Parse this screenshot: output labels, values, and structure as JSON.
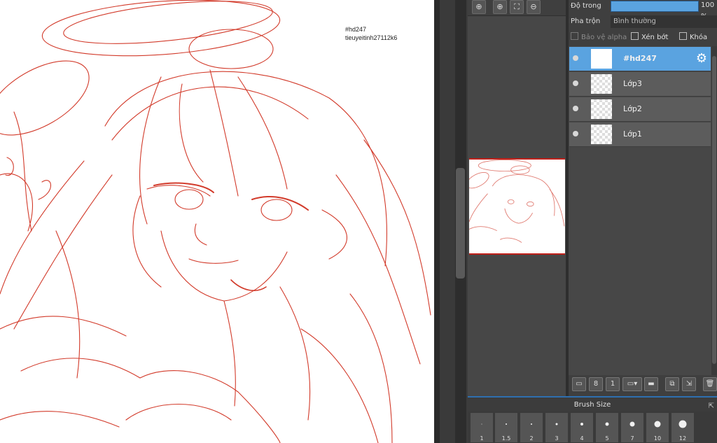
{
  "canvas": {
    "hashtag": "#hd247",
    "username": "tieuyeitinh27112k6"
  },
  "navigator": {
    "zoom_in_label": "⊕",
    "zoom_fit_label": "⛶",
    "zoom_out_label": "⊖"
  },
  "layer_props": {
    "opacity_label": "Độ trong",
    "opacity_value": "100 %",
    "opacity_fraction": 1.0,
    "blend_label": "Pha trộn",
    "blend_value": "Bình thường",
    "protect_alpha_label": "Bảo vệ alpha",
    "clipping_label": "Xén bớt",
    "lock_label": "Khóa"
  },
  "layers": [
    {
      "name": "#hd247",
      "selected": true
    },
    {
      "name": "Lớp3",
      "selected": false
    },
    {
      "name": "Lớp2",
      "selected": false
    },
    {
      "name": "Lớp1",
      "selected": false
    }
  ],
  "brush_panel": {
    "title": "Brush Size",
    "sizes": [
      "1",
      "1.5",
      "2",
      "3",
      "4",
      "5",
      "7",
      "10",
      "12"
    ]
  },
  "colors": {
    "accent": "#5aa3e0",
    "sketch": "#d23a2a"
  },
  "icons": [
    "zoom-in-icon",
    "zoom-fit-icon",
    "zoom-out-icon",
    "gear-icon",
    "new-layer-icon",
    "folder-icon",
    "delete-icon",
    "popout-icon"
  ]
}
